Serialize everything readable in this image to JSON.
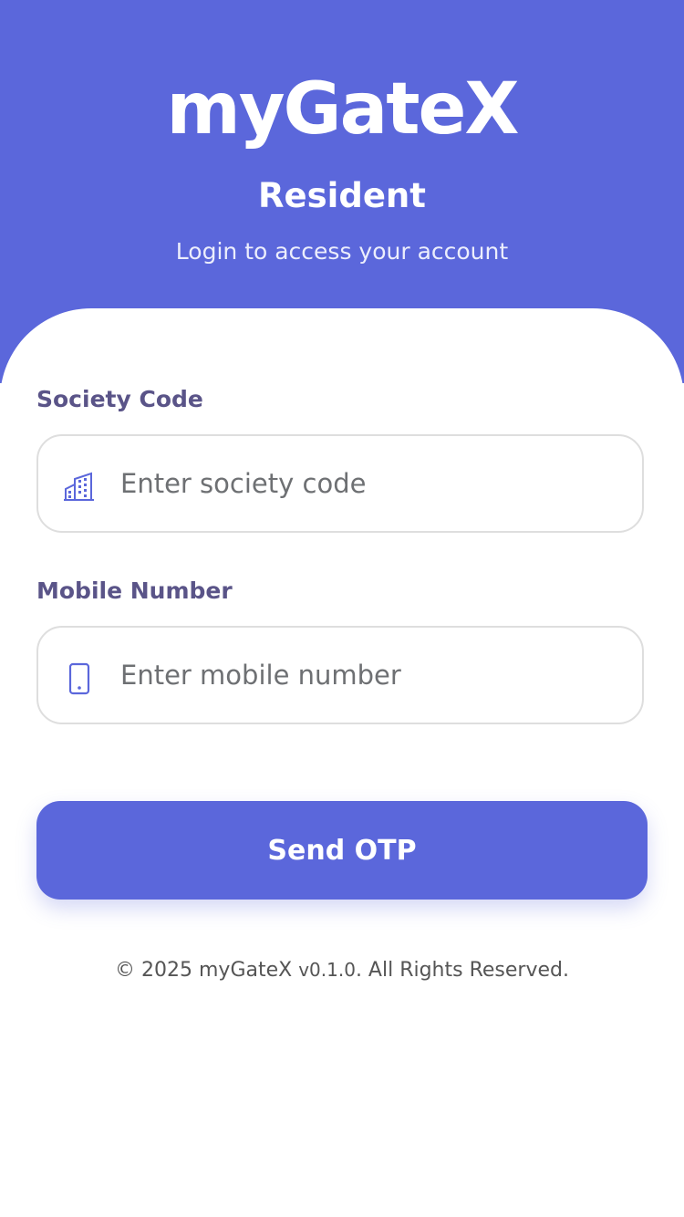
{
  "header": {
    "logo": "myGateX",
    "role": "Resident",
    "subtitle": "Login to access your account"
  },
  "form": {
    "society_code": {
      "label": "Society Code",
      "placeholder": "Enter society code",
      "value": "",
      "icon": "building-icon"
    },
    "mobile_number": {
      "label": "Mobile Number",
      "placeholder": "Enter mobile number",
      "value": "",
      "icon": "mobile-phone-icon"
    },
    "submit_label": "Send OTP"
  },
  "footer": {
    "copyright_prefix": "© 2025 myGateX ",
    "version": "v0.1.0",
    "copyright_suffix": ". All Rights Reserved."
  },
  "colors": {
    "primary": "#5b67db",
    "label": "#5a5488",
    "border": "#dedede"
  }
}
